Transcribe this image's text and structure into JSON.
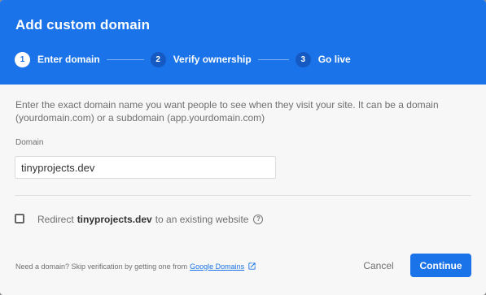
{
  "dialog": {
    "title": "Add custom domain"
  },
  "stepper": {
    "steps": [
      {
        "number": "1",
        "label": "Enter domain",
        "state": "active"
      },
      {
        "number": "2",
        "label": "Verify ownership",
        "state": "inactive"
      },
      {
        "number": "3",
        "label": "Go live",
        "state": "inactive"
      }
    ]
  },
  "form": {
    "description": "Enter the exact domain name you want people to see when they visit your site. It can be a domain (yourdomain.com) or a subdomain (app.yourdomain.com)",
    "domain_label": "Domain",
    "domain_value": "tinyprojects.dev"
  },
  "redirect": {
    "checked": false,
    "prefix": "Redirect",
    "domain": "tinyprojects.dev",
    "suffix": "to an existing website",
    "help_icon": "help-circle-icon"
  },
  "footer": {
    "note": "Need a domain? Skip verification by getting one from",
    "link_text": "Google Domains",
    "link_icon": "open-in-new-icon",
    "cancel_label": "Cancel",
    "continue_label": "Continue"
  },
  "colors": {
    "primary": "#1a73e8",
    "header_bg": "#1a73e8",
    "dialog_bg": "#f7f7f7"
  }
}
